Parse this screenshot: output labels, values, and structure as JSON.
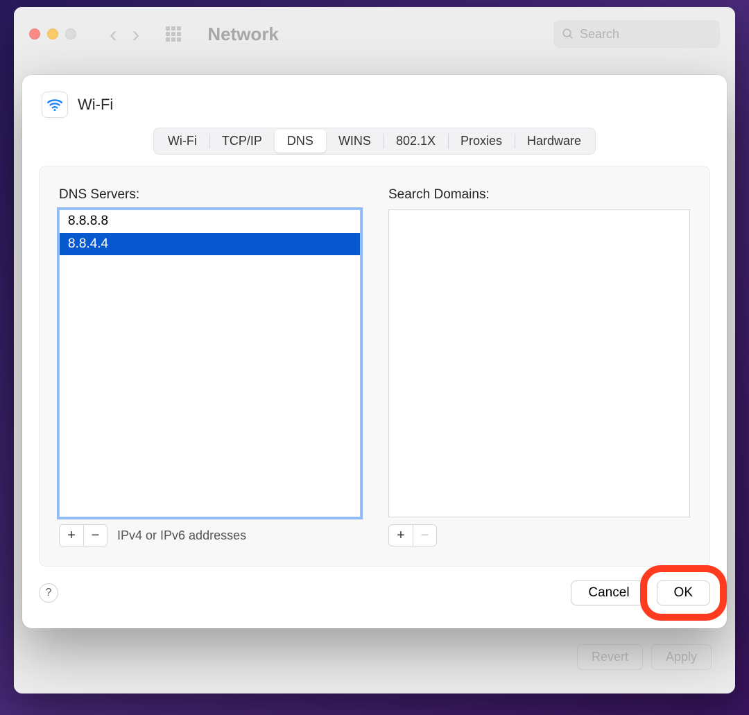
{
  "parent": {
    "title": "Network",
    "search_placeholder": "Search",
    "buttons": {
      "revert": "Revert",
      "apply": "Apply"
    }
  },
  "sheet": {
    "title": "Wi-Fi",
    "tabs": [
      {
        "label": "Wi-Fi"
      },
      {
        "label": "TCP/IP"
      },
      {
        "label": "DNS"
      },
      {
        "label": "WINS"
      },
      {
        "label": "802.1X"
      },
      {
        "label": "Proxies"
      },
      {
        "label": "Hardware"
      }
    ],
    "active_tab": "DNS",
    "dns": {
      "servers_label": "DNS Servers:",
      "servers": [
        "8.8.8.8",
        "8.8.4.4"
      ],
      "selected_index": 1,
      "hint": "IPv4 or IPv6 addresses"
    },
    "search_domains": {
      "label": "Search Domains:",
      "domains": []
    },
    "buttons": {
      "cancel": "Cancel",
      "ok": "OK",
      "help": "?"
    }
  },
  "colors": {
    "selection": "#0858d0",
    "accent_ring": "#ff3b1f"
  }
}
